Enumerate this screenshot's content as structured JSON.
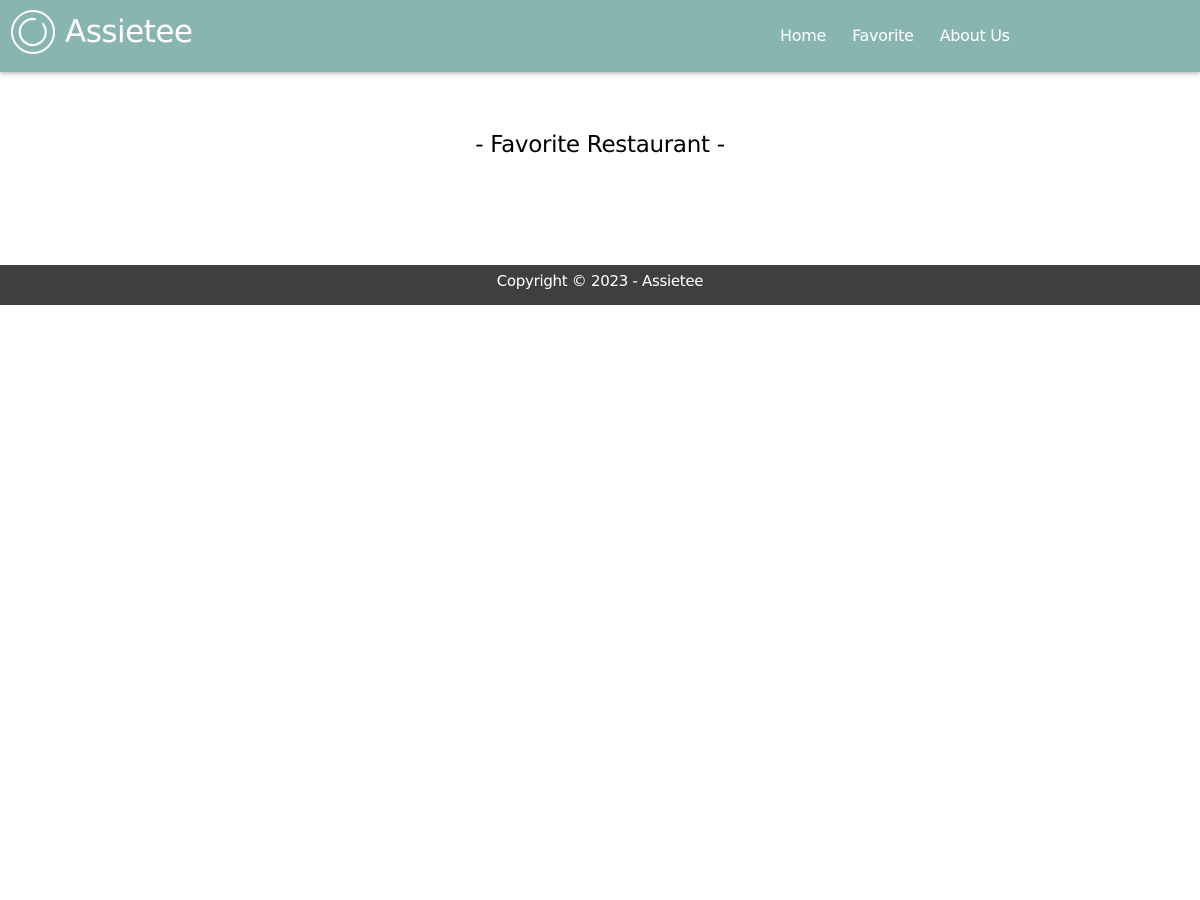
{
  "brand": {
    "name": "Assietee",
    "logo_icon": "ring-logo-icon"
  },
  "nav": {
    "items": [
      {
        "label": "Home"
      },
      {
        "label": "Favorite"
      },
      {
        "label": "About Us"
      }
    ]
  },
  "main": {
    "title": "- Favorite Restaurant -"
  },
  "footer": {
    "copyright": "Copyright © 2023 - Assietee"
  },
  "colors": {
    "header_bg": "#88b5b0",
    "footer_bg": "#3f403e",
    "header_text": "#ffffff",
    "page_bg": "#ffffff"
  }
}
